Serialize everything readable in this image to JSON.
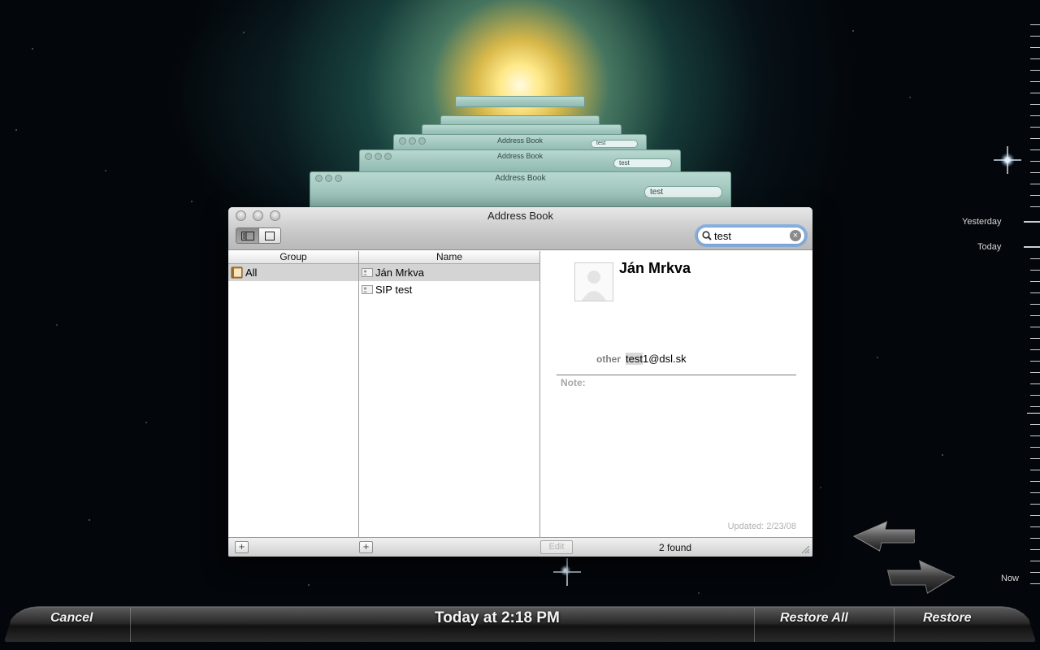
{
  "window": {
    "title": "Address Book",
    "search_value": "test"
  },
  "ghost_windows": [
    {
      "title": "Address Book",
      "search": "test"
    },
    {
      "title": "Address Book",
      "search": "test"
    },
    {
      "title": "Address Book",
      "search": "test"
    },
    {
      "title": "Address Book",
      "search": ""
    }
  ],
  "columns": {
    "group_header": "Group",
    "name_header": "Name"
  },
  "groups": [
    {
      "label": "All",
      "selected": true
    }
  ],
  "names": [
    {
      "label": "Ján Mrkva",
      "selected": true
    },
    {
      "label": "SIP test",
      "selected": false
    }
  ],
  "card": {
    "name": "Ján Mrkva",
    "email_label": "other",
    "email_highlight": "test",
    "email_rest": "1@dsl.sk",
    "note_label": "Note:",
    "updated": "Updated: 2/23/08"
  },
  "bottom": {
    "add_group": "+",
    "add_person": "+",
    "edit": "Edit",
    "found": "2 found"
  },
  "timeline": {
    "yesterday": "Yesterday",
    "today": "Today",
    "now": "Now"
  },
  "time_machine": {
    "cancel": "Cancel",
    "date": "Today at 2:18 PM",
    "restore_all": "Restore All",
    "restore": "Restore"
  },
  "colors": {
    "search_focus": "#6f9fd8",
    "selection": "#d4d4d4",
    "ghost_window": "#a6cbc2"
  }
}
